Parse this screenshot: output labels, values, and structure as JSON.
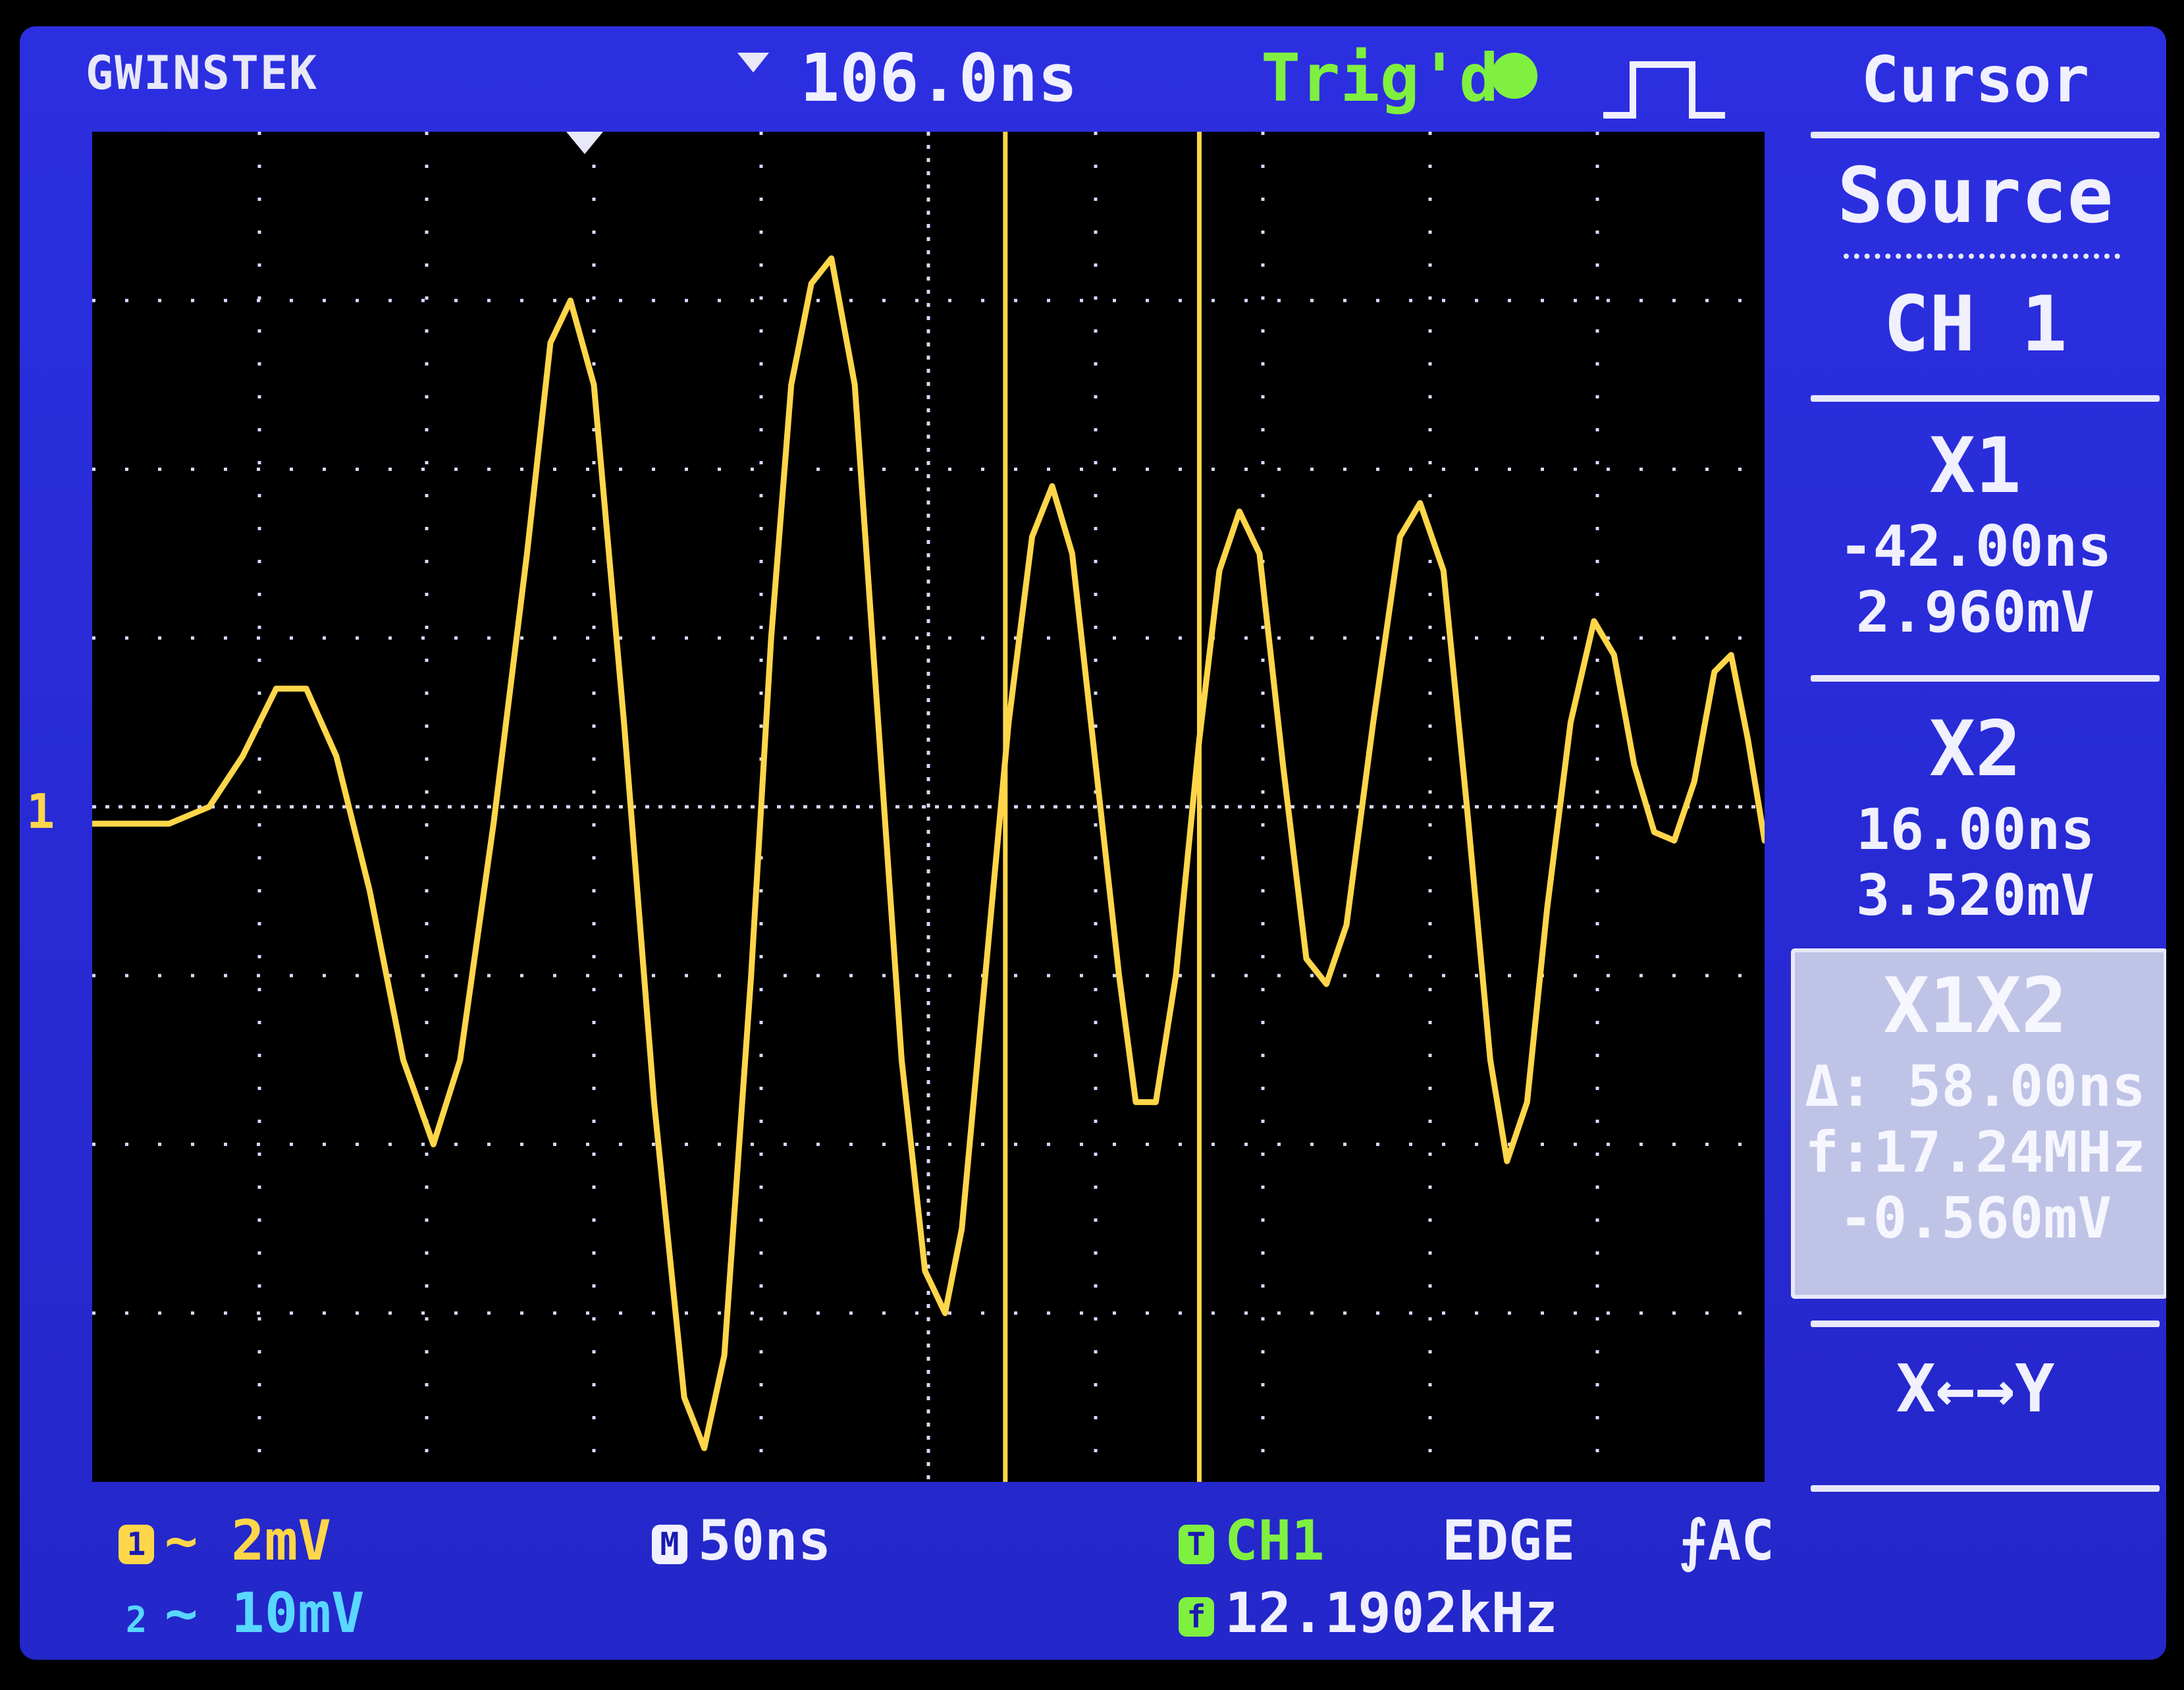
{
  "header": {
    "brand": "GWINSTEK",
    "delay": "106.0ns",
    "trigger_status": "Trig'd",
    "trigger_icon": "trigger-dot-icon",
    "pulse_icon": "pulse-edge-icon"
  },
  "screen": {
    "channel_marker": "1",
    "trigger_position_icon": "trigger-position-marker-icon",
    "divisions_x": 10,
    "divisions_y": 8
  },
  "menu": {
    "title": "Cursor",
    "source_label": "Source",
    "source_value": "CH 1",
    "x1_label": "X1",
    "x1_time": "-42.00ns",
    "x1_volt": "2.960mV",
    "x2_label": "X2",
    "x2_time": "16.00ns",
    "x2_volt": "3.520mV",
    "x1x2_label": "X1X2",
    "delta_time": "Δ: 58.00ns",
    "freq": "f:17.24MHz",
    "delta_volt": "-0.560mV",
    "xy_label": "X←→Y"
  },
  "footer": {
    "ch1_badge": "1",
    "ch1_scale": "~ 2mV",
    "ch2_badge": "2",
    "ch2_scale": "~ 10mV",
    "time_badge": "M",
    "time_scale": "50ns",
    "trig_badge": "T",
    "trig_source": "CH1",
    "trig_type": "EDGE",
    "trig_coupling": "⨍AC",
    "freq_badge": "f",
    "freq_value": "12.1902kHz"
  },
  "colors": {
    "background": "#2a2bd8",
    "ch1": "#ffd64a",
    "ch2": "#58d7ff",
    "trigger": "#7ff040",
    "grid": "#d8d8ff"
  },
  "chart_data": {
    "type": "line",
    "x_unit": "ns",
    "y_unit": "mV",
    "xlim": [
      -315,
      185
    ],
    "ylim": [
      -8,
      8
    ],
    "series": [
      {
        "points": [
          [
            -315,
            -0.2
          ],
          [
            -292,
            -0.2
          ],
          [
            -280,
            0.0
          ],
          [
            -270,
            0.6
          ],
          [
            -260,
            1.4
          ],
          [
            -251,
            1.4
          ],
          [
            -242,
            0.6
          ],
          [
            -232,
            -1.0
          ],
          [
            -222,
            -3.0
          ],
          [
            -213,
            -4.0
          ],
          [
            -205,
            -3.0
          ],
          [
            -195,
            -0.2
          ],
          [
            -185,
            3.0
          ],
          [
            -178,
            5.5
          ],
          [
            -172,
            6.0
          ],
          [
            -165,
            5.0
          ],
          [
            -156,
            1.0
          ],
          [
            -147,
            -3.5
          ],
          [
            -138,
            -7.0
          ],
          [
            -132,
            -7.6
          ],
          [
            -126,
            -6.5
          ],
          [
            -118,
            -2.0
          ],
          [
            -112,
            2.0
          ],
          [
            -106,
            5.0
          ],
          [
            -100,
            6.2
          ],
          [
            -94,
            6.5
          ],
          [
            -87,
            5.0
          ],
          [
            -80,
            1.0
          ],
          [
            -73,
            -3.0
          ],
          [
            -66,
            -5.5
          ],
          [
            -60,
            -6.0
          ],
          [
            -55,
            -5.0
          ],
          [
            -48,
            -2.0
          ],
          [
            -41,
            1.0
          ],
          [
            -34,
            3.2
          ],
          [
            -28,
            3.8
          ],
          [
            -22,
            3.0
          ],
          [
            -15,
            0.5
          ],
          [
            -8,
            -2.0
          ],
          [
            -3,
            -3.5
          ],
          [
            3,
            -3.5
          ],
          [
            9,
            -2.0
          ],
          [
            16,
            0.8
          ],
          [
            22,
            2.8
          ],
          [
            28,
            3.5
          ],
          [
            34,
            3.0
          ],
          [
            41,
            0.5
          ],
          [
            48,
            -1.8
          ],
          [
            54,
            -2.1
          ],
          [
            60,
            -1.4
          ],
          [
            68,
            1.0
          ],
          [
            76,
            3.2
          ],
          [
            82,
            3.6
          ],
          [
            89,
            2.8
          ],
          [
            96,
            0.0
          ],
          [
            103,
            -3.0
          ],
          [
            108,
            -4.2
          ],
          [
            114,
            -3.5
          ],
          [
            120,
            -1.2
          ],
          [
            127,
            1.0
          ],
          [
            134,
            2.2
          ],
          [
            140,
            1.8
          ],
          [
            146,
            0.5
          ],
          [
            152,
            -0.3
          ],
          [
            158,
            -0.4
          ],
          [
            164,
            0.3
          ],
          [
            170,
            1.6
          ],
          [
            175,
            1.8
          ],
          [
            180,
            0.8
          ],
          [
            185,
            -0.4
          ]
        ]
      }
    ],
    "cursors": [
      {
        "label": "X1",
        "x": -42.0,
        "y": 2.96
      },
      {
        "label": "X2",
        "x": 16.0,
        "y": 3.52
      }
    ]
  }
}
